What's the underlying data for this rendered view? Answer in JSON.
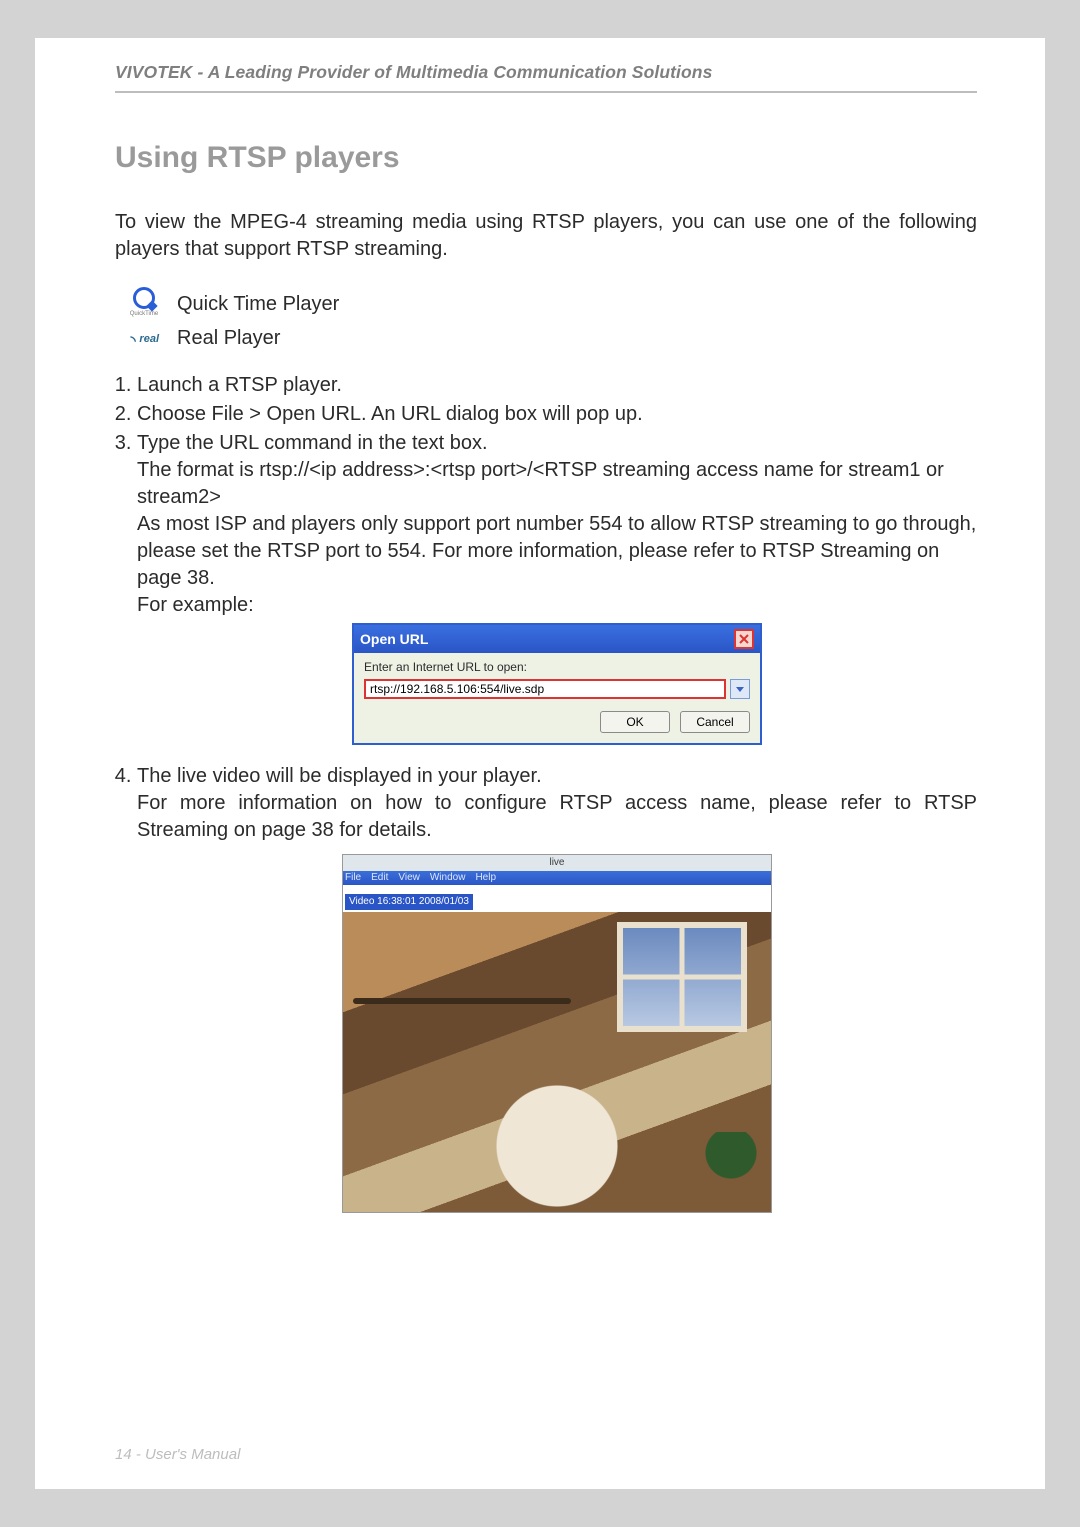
{
  "header": {
    "line": "VIVOTEK - A Leading Provider of Multimedia Communication Solutions"
  },
  "title": "Using RTSP players",
  "intro": "To view the MPEG-4 streaming media using RTSP players, you can use one of the following players that support RTSP streaming.",
  "players": {
    "qt": {
      "label": "Quick Time Player",
      "sub": "QuickTime"
    },
    "real": {
      "label": "Real Player",
      "sub": "real"
    }
  },
  "steps": {
    "s1": "Launch a RTSP player.",
    "s2": "Choose File > Open URL. An URL dialog box will pop up.",
    "s3": {
      "head": "Type the URL command in the text box.",
      "l1": "The format is rtsp://<ip address>:<rtsp port>/<RTSP streaming access name for stream1 or stream2>",
      "l2": "As most ISP and players only support port number 554 to allow RTSP streaming to go through, please set the RTSP port to 554. For more information, please refer to RTSP Streaming on page 38.",
      "l3": "For example:"
    },
    "s4": {
      "head": "The live video will be displayed in your player.",
      "body": "For more information on how to configure RTSP access name, please refer to RTSP Streaming on page 38 for details."
    }
  },
  "dialog": {
    "title": "Open URL",
    "label": "Enter an Internet URL to open:",
    "value": "rtsp://192.168.5.106:554/live.sdp",
    "ok": "OK",
    "cancel": "Cancel"
  },
  "video": {
    "title": "live",
    "menu": [
      "File",
      "Edit",
      "View",
      "Window",
      "Help"
    ],
    "overlay": "Video 16:38:01 2008/01/03"
  },
  "footer": "14 - User's Manual"
}
